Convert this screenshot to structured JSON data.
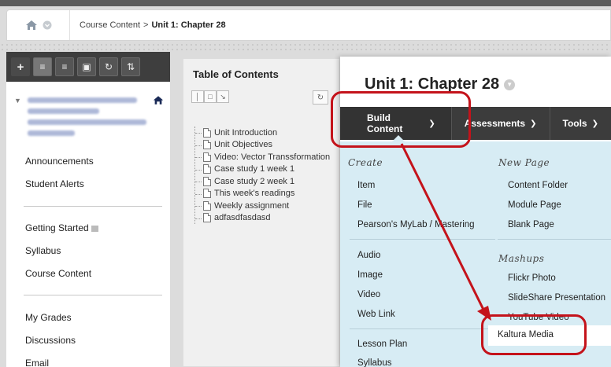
{
  "breadcrumb": {
    "path": "Course Content",
    "separator": ">",
    "current": "Unit 1: Chapter 28"
  },
  "leftnav": {
    "tools": [
      "+",
      "≡",
      "≡",
      "▣",
      "↻",
      "⇅"
    ],
    "links_group1": [
      "Announcements",
      "Student Alerts"
    ],
    "links_group2": [
      "Getting Started",
      "Syllabus",
      "Course Content"
    ],
    "links_group3": [
      "My Grades",
      "Discussions",
      "Email"
    ]
  },
  "toc": {
    "title": "Table of Contents",
    "items": [
      "Unit Introduction",
      "Unit Objectives",
      "Video: Vector Transsformation",
      "Case study 1 week 1",
      "Case study 2 week 1",
      "This week's readings",
      "Weekly assignment",
      "adfasdfasdasd"
    ]
  },
  "main": {
    "title": "Unit 1: Chapter 28",
    "actions": [
      "Build Content",
      "Assessments",
      "Tools"
    ]
  },
  "menu": {
    "create_heading": "Create",
    "create_items": [
      "Item",
      "File",
      "Pearson's MyLab / Mastering"
    ],
    "create_items2": [
      "Audio",
      "Image",
      "Video",
      "Web Link"
    ],
    "create_items3": [
      "Lesson Plan",
      "Syllabus"
    ],
    "newpage_heading": "New Page",
    "newpage_items": [
      "Content Folder",
      "Module Page",
      "Blank Page"
    ],
    "mashups_heading": "Mashups",
    "mashups_items": [
      "Flickr Photo",
      "SlideShare Presentation",
      "YouTube Video",
      "Kaltura Media"
    ]
  },
  "colors": {
    "annotation": "#c4131b",
    "menu_bg": "#d7ecf4",
    "actionbar": "#3c3c3c"
  }
}
